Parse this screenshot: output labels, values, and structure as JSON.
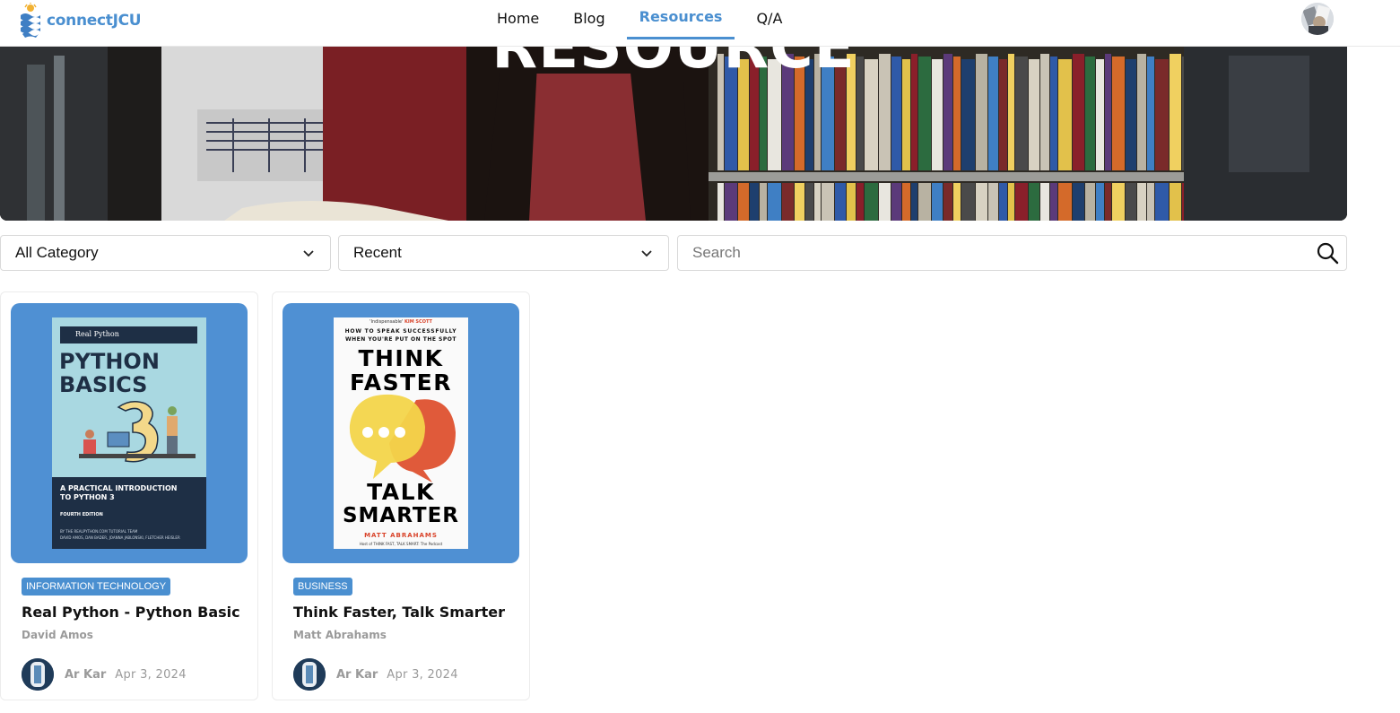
{
  "nav": {
    "logo_text": "connectJCU",
    "links": [
      {
        "label": "Home",
        "active": false
      },
      {
        "label": "Blog",
        "active": false
      },
      {
        "label": "Resources",
        "active": true
      },
      {
        "label": "Q/A",
        "active": false
      }
    ]
  },
  "hero": {
    "title": "RESOURCE"
  },
  "filters": {
    "category": "All Category",
    "sort": "Recent",
    "search_placeholder": "Search"
  },
  "cards": [
    {
      "category": "INFORMATION TECHNOLOGY",
      "title": "Real Python - Python Basic",
      "author": "David Amos",
      "posted_by": "Ar Kar",
      "date": "Apr 3, 2024",
      "cover": {
        "brand": "Real Python",
        "title_line1": "PYTHON",
        "title_line2": "BASICS",
        "subtitle_line1": "A PRACTICAL INTRODUCTION",
        "subtitle_line2": "TO PYTHON 3",
        "edition": "FOURTH EDITION",
        "credit_line1": "BY THE REALPYTHON.COM TUTORIAL TEAM",
        "credit_line2": "DAVID AMOS, DAN BADER, JOANNA JABLONSKI, FLETCHER HEISLER"
      }
    },
    {
      "category": "BUSINESS",
      "title": "Think Faster, Talk Smarter",
      "author": "Matt Abrahams",
      "posted_by": "Ar Kar",
      "date": "Apr 3, 2024",
      "cover": {
        "blurb_prefix": "'Indispensable'",
        "blurb_name": "KIM SCOTT",
        "tagline1": "HOW TO SPEAK SUCCESSFULLY",
        "tagline2": "WHEN YOU'RE PUT ON THE SPOT",
        "title1": "THINK",
        "title2": "FASTER",
        "title3": "TALK",
        "title4": "SMARTER",
        "author": "MATT ABRAHAMS",
        "host_line": "Host of THINK FAST, TALK SMART: The Podcast"
      }
    }
  ],
  "colors": {
    "accent": "#4a8fd0",
    "card_cover_bg": "#4f90d3"
  }
}
